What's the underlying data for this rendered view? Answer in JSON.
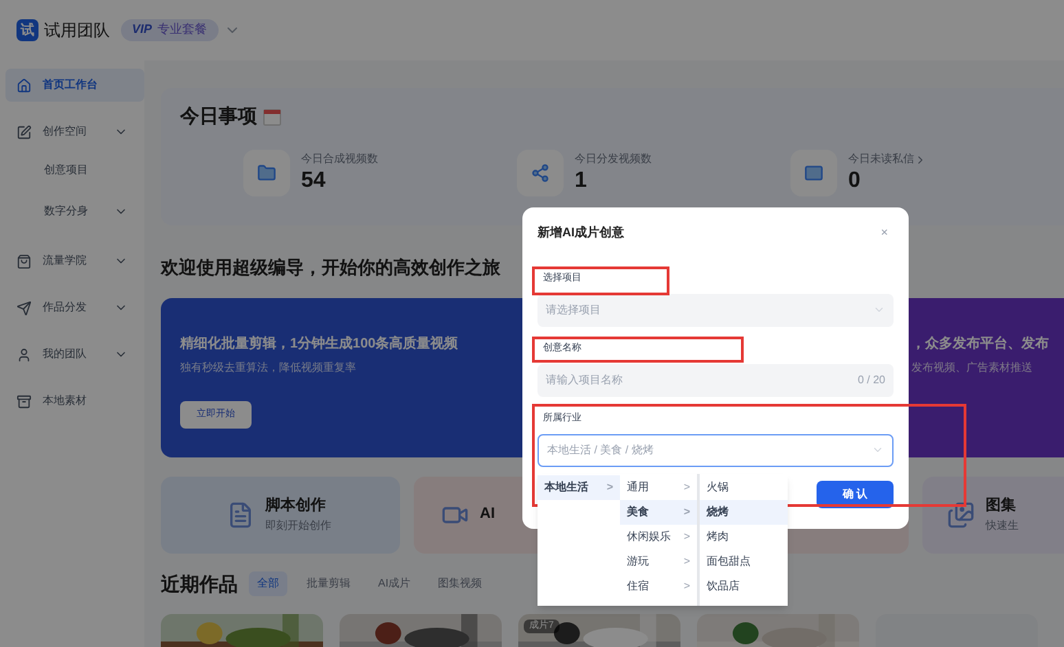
{
  "header": {
    "logo": "试",
    "team": "试用团队",
    "vip": "VIP",
    "plan": "专业套餐"
  },
  "sidebar": {
    "items": [
      {
        "label": "首页工作台",
        "selected": true,
        "expandable": false
      },
      {
        "label": "创作空间",
        "selected": false,
        "expandable": true,
        "children": [
          {
            "label": "创意项目",
            "expandable": false
          },
          {
            "label": "数字分身",
            "expandable": true
          }
        ]
      },
      {
        "label": "流量学院",
        "selected": false,
        "expandable": true
      },
      {
        "label": "作品分发",
        "selected": false,
        "expandable": true
      },
      {
        "label": "我的团队",
        "selected": false,
        "expandable": true
      },
      {
        "label": "本地素材",
        "selected": false,
        "expandable": false
      }
    ]
  },
  "today": {
    "title": "今日事项",
    "stats": [
      {
        "label": "今日合成视频数",
        "value": "54",
        "link": false
      },
      {
        "label": "今日分发视频数",
        "value": "1",
        "link": false
      },
      {
        "label": "今日未读私信",
        "value": "0",
        "link": true
      }
    ]
  },
  "welcome": "欢迎使用超级编导，开始你的高效创作之旅",
  "banners": [
    {
      "title": "精细化批量剪辑，1分钟生成100条高质量视频",
      "subtitle": "独有秒级去重算法，降低视频重复率",
      "button": "立即开始"
    },
    {
      "title": "，众多发布平台、发布",
      "subtitle": "发布视频、广告素材推送"
    }
  ],
  "features": [
    {
      "title": "脚本创作",
      "subtitle": "即刻开始创作"
    },
    {
      "title": "AI"
    },
    {
      "title": "图集",
      "subtitle": "快速生"
    }
  ],
  "recent": {
    "title": "近期作品",
    "tabs": [
      {
        "label": "全部",
        "selected": true
      },
      {
        "label": "批量剪辑",
        "selected": false
      },
      {
        "label": "AI成片",
        "selected": false
      },
      {
        "label": "图集视频",
        "selected": false
      }
    ],
    "thumbs": [
      {
        "kind": "picture"
      },
      {
        "kind": "picture"
      },
      {
        "kind": "picture",
        "badge": "成片7"
      },
      {
        "kind": "picture"
      },
      {
        "kind": "empty"
      }
    ]
  },
  "dialog": {
    "title": "新增AI成片创意",
    "close": "×",
    "fields": [
      {
        "label": "选择项目",
        "kind": "select",
        "placeholder": "请选择项目",
        "focused": false,
        "highlighted": true
      },
      {
        "label": "创意名称",
        "kind": "text",
        "placeholder": "请输入项目名称",
        "counter": "0 / 20",
        "focused": false,
        "highlighted": true
      },
      {
        "label": "所属行业",
        "kind": "select",
        "placeholder": "本地生活 / 美食 / 烧烤",
        "focused": true,
        "highlighted": true
      }
    ],
    "confirm": "确 认"
  },
  "cascader": [
    [
      {
        "label": "本地生活",
        "selected": true,
        "arrow": ">"
      }
    ],
    [
      {
        "label": "通用",
        "selected": false,
        "arrow": ">"
      },
      {
        "label": "美食",
        "selected": true,
        "arrow": ">"
      },
      {
        "label": "休闲娱乐",
        "selected": false,
        "arrow": ">"
      },
      {
        "label": "游玩",
        "selected": false,
        "arrow": ">"
      },
      {
        "label": "住宿",
        "selected": false,
        "arrow": ">"
      }
    ],
    [
      {
        "label": "火锅",
        "selected": false
      },
      {
        "label": "烧烤",
        "selected": true
      },
      {
        "label": "烤肉",
        "selected": false
      },
      {
        "label": "面包甜点",
        "selected": false
      },
      {
        "label": "饮品店",
        "selected": false
      }
    ]
  ]
}
